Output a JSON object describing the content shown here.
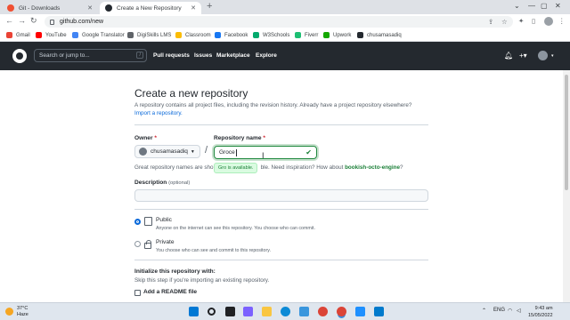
{
  "browser": {
    "tabs": [
      {
        "title": "Git - Downloads",
        "active": false
      },
      {
        "title": "Create a New Repository",
        "active": true
      }
    ],
    "url": "github.com/new",
    "bookmarks": [
      {
        "label": "Gmail",
        "color": "#ea4335"
      },
      {
        "label": "YouTube",
        "color": "#ff0000"
      },
      {
        "label": "Google Translator",
        "color": "#4285f4"
      },
      {
        "label": "DigiSkills LMS",
        "color": "#5f6368"
      },
      {
        "label": "Classroom",
        "color": "#fbbc04"
      },
      {
        "label": "Facebook",
        "color": "#1877f2"
      },
      {
        "label": "W3Schools",
        "color": "#04aa6d"
      },
      {
        "label": "Fiverr",
        "color": "#1dbf73"
      },
      {
        "label": "Upwork",
        "color": "#14a800"
      },
      {
        "label": "chusamasadiq",
        "color": "#24292f"
      }
    ]
  },
  "github_header": {
    "search_placeholder": "Search or jump to...",
    "search_shortcut": "/",
    "nav": [
      "Pull requests",
      "Issues",
      "Marketplace",
      "Explore"
    ]
  },
  "form": {
    "title": "Create a new repository",
    "subtitle": "A repository contains all project files, including the revision history. Already have a project repository elsewhere?",
    "import_link": "Import a repository.",
    "owner_label": "Owner",
    "required_mark": "*",
    "owner_value": "chusamasadiq",
    "repo_name_label": "Repository name",
    "repo_name_value": "Groce",
    "availability_tooltip": "Gro is available.",
    "suggestion_prefix": "Great repository names are sho",
    "suggestion_mid": "ble. Need inspiration? How about",
    "suggestion_name": "bookish-octo-engine",
    "suggestion_suffix": "?",
    "description_label": "Description",
    "description_optional": "(optional)",
    "description_value": "",
    "visibility": [
      {
        "label": "Public",
        "desc": "Anyone on the internet can see this repository. You choose who can commit.",
        "selected": true
      },
      {
        "label": "Private",
        "desc": "You choose who can see and commit to this repository.",
        "selected": false
      }
    ],
    "init_title": "Initialize this repository with:",
    "init_subtitle": "Skip this step if you're importing an existing repository.",
    "readme_label": "Add a README file",
    "readme_checked": false
  },
  "taskbar": {
    "weather_temp": "37°C",
    "weather_desc": "Haze",
    "time": "9:43 am",
    "date": "15/05/2022"
  }
}
